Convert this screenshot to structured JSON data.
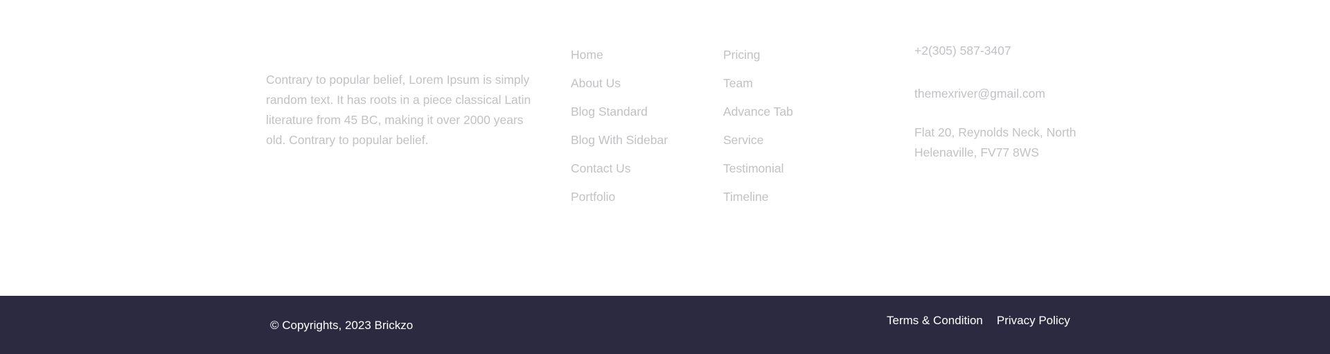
{
  "about": {
    "text": "Contrary to popular belief, Lorem Ipsum is simply random text. It has roots in a piece classical Latin literature from 45 BC, making it over 2000 years old. Contrary to popular belief."
  },
  "links_col_1": [
    "Home",
    "About Us",
    "Blog Standard",
    "Blog With Sidebar",
    "Contact Us",
    "Portfolio"
  ],
  "links_col_2": [
    "Pricing",
    "Team",
    "Advance Tab",
    "Service",
    "Testimonial",
    "Timeline"
  ],
  "contact": {
    "phone": "+2(305) 587-3407",
    "email": "themexriver@gmail.com",
    "address": "Flat 20, Reynolds Neck, North Helenaville, FV77 8WS"
  },
  "bottom_bar": {
    "copyright": "© Copyrights, 2023 Brickzo",
    "terms_label": "Terms & Condition",
    "privacy_label": "Privacy Policy"
  },
  "colors": {
    "muted_text": "#c2c2c6",
    "bottom_bar_bg": "#2c2a40",
    "bottom_bar_text": "#ffffff"
  }
}
